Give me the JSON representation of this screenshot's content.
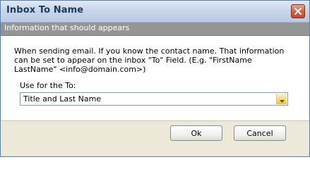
{
  "window": {
    "title": "Inbox To Name",
    "close_icon": "close-icon",
    "subheader": "Information that should appears"
  },
  "content": {
    "description": "When sending email. If you know the contact name. That information can be set to appear on the inbox \"To\" Field. (E.g. \"FirstName LastName\" <info@domain.com>)",
    "use_label": "Use for the To:",
    "select_value": "Title and Last Name"
  },
  "buttons": {
    "ok": "Ok",
    "cancel": "Cancel"
  },
  "colors": {
    "close_button": "#d8623f",
    "subheader_bg": "#959595",
    "dropdown_arrow": "#f3d66f"
  }
}
